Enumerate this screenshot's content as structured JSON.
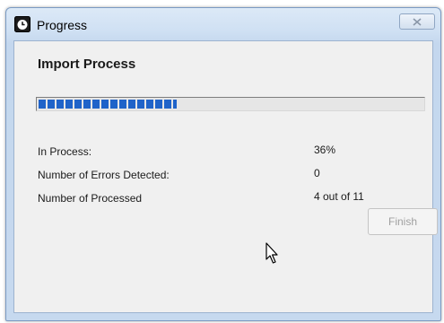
{
  "window": {
    "title": "Progress",
    "app_icon": "clock-app-icon",
    "close_icon": "close-icon"
  },
  "main": {
    "heading": "Import Process",
    "progress": {
      "fraction": 0.36,
      "color": "#1f63c9"
    },
    "stats": [
      {
        "label": "In Process:",
        "value": "36%"
      },
      {
        "label": "Number of Errors Detected:",
        "value": "0"
      },
      {
        "label": "Number of Processed",
        "value": "4 out of 11"
      }
    ],
    "finish_label": "Finish"
  },
  "cursor": "mouse-pointer-icon"
}
